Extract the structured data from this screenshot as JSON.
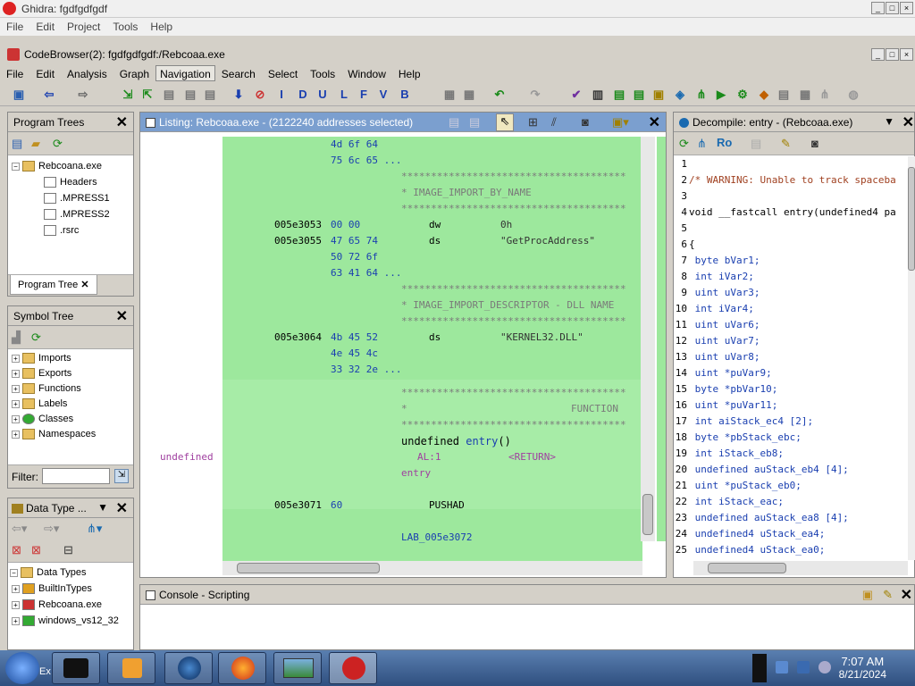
{
  "outer": {
    "title": "Ghidra: fgdfgdfgdf",
    "menu": [
      "File",
      "Edit",
      "Project",
      "Tools",
      "Help"
    ]
  },
  "inner": {
    "title": "CodeBrowser(2): fgdfgdfgdf:/Rebcoaa.exe",
    "menu": [
      "File",
      "Edit",
      "Analysis",
      "Graph",
      "Navigation",
      "Search",
      "Select",
      "Tools",
      "Window",
      "Help"
    ],
    "toolbar_letters": [
      "I",
      "D",
      "U",
      "L",
      "F",
      "V",
      "B"
    ]
  },
  "program_trees": {
    "title": "Program Trees",
    "root": "Rebcoana.exe",
    "items": [
      "Headers",
      ".MPRESS1",
      ".MPRESS2",
      ".rsrc"
    ],
    "tab": "Program Tree"
  },
  "symbol_tree": {
    "title": "Symbol Tree",
    "items": [
      "Imports",
      "Exports",
      "Functions",
      "Labels",
      "Classes",
      "Namespaces"
    ],
    "filter_label": "Filter:"
  },
  "data_types": {
    "title": "Data Type ...",
    "root": "Data Types",
    "items": [
      "BuiltInTypes",
      "Rebcoana.exe",
      "windows_vs12_32"
    ]
  },
  "listing": {
    "title": "Listing:  Rebcoaa.exe - (2122240 addresses selected)",
    "rows": [
      {
        "addr": "",
        "bytes": "4d 6f 64",
        "mn": "",
        "op": ""
      },
      {
        "addr": "",
        "bytes": "75 6c 65 ...",
        "mn": "",
        "op": ""
      },
      {
        "star": "**************************************"
      },
      {
        "comment": "* IMAGE_IMPORT_BY_NAME"
      },
      {
        "star": "**************************************"
      },
      {
        "addr": "005e3053",
        "bytes": "00 00",
        "mn": "dw",
        "op": "0h"
      },
      {
        "addr": "005e3055",
        "bytes": "47 65 74",
        "mn": "ds",
        "op": "\"GetProcAddress\""
      },
      {
        "addr": "",
        "bytes": "50 72 6f",
        "mn": "",
        "op": ""
      },
      {
        "addr": "",
        "bytes": "63 41 64 ...",
        "mn": "",
        "op": ""
      },
      {
        "star": "**************************************"
      },
      {
        "comment": "* IMAGE_IMPORT_DESCRIPTOR - DLL NAME"
      },
      {
        "star": "**************************************"
      },
      {
        "addr": "005e3064",
        "bytes": "4b 45 52",
        "mn": "ds",
        "op": "\"KERNEL32.DLL\""
      },
      {
        "addr": "",
        "bytes": "4e 45 4c",
        "mn": "",
        "op": ""
      },
      {
        "addr": "",
        "bytes": "33 32 2e ...",
        "mn": "",
        "op": ""
      }
    ],
    "func_star": "**************************************",
    "func_comment_left": "*",
    "func_comment_right": "FUNCTION",
    "func_sig_type": "undefined ",
    "func_sig_name": "entry",
    "func_sig_paren": "()",
    "ret_type": "undefined",
    "ret_reg": "AL:1",
    "ret_label": "<RETURN>",
    "entry_label": "entry",
    "pushad": {
      "addr": "005e3071",
      "bytes": "60",
      "mn": "PUSHAD"
    },
    "lab_label": "LAB_005e3072"
  },
  "decompile": {
    "title": "Decompile: entry -  (Rebcoaa.exe)",
    "lines": [
      {
        "n": "1",
        "text": ""
      },
      {
        "n": "2",
        "text": "/* WARNING: Unable to track spaceba"
      },
      {
        "n": "3",
        "text": ""
      },
      {
        "n": "4",
        "text": "void __fastcall entry(undefined4 pa"
      },
      {
        "n": "5",
        "text": ""
      },
      {
        "n": "6",
        "text": "{"
      },
      {
        "n": "7",
        "text": "  byte bVar1;"
      },
      {
        "n": "8",
        "text": "  int iVar2;"
      },
      {
        "n": "9",
        "text": "  uint uVar3;"
      },
      {
        "n": "10",
        "text": "  int iVar4;"
      },
      {
        "n": "11",
        "text": "  uint uVar6;"
      },
      {
        "n": "12",
        "text": "  uint uVar7;"
      },
      {
        "n": "13",
        "text": "  uint uVar8;"
      },
      {
        "n": "14",
        "text": "  uint *puVar9;"
      },
      {
        "n": "15",
        "text": "  byte *pbVar10;"
      },
      {
        "n": "16",
        "text": "  uint *puVar11;"
      },
      {
        "n": "17",
        "text": "  int aiStack_ec4 [2];"
      },
      {
        "n": "18",
        "text": "  byte *pbStack_ebc;"
      },
      {
        "n": "19",
        "text": "  int iStack_eb8;"
      },
      {
        "n": "20",
        "text": "  undefined auStack_eb4 [4];"
      },
      {
        "n": "21",
        "text": "  uint *puStack_eb0;"
      },
      {
        "n": "22",
        "text": "  int iStack_eac;"
      },
      {
        "n": "23",
        "text": "  undefined auStack_ea8 [4];"
      },
      {
        "n": "24",
        "text": "  undefined4 uStack_ea4;"
      },
      {
        "n": "25",
        "text": "  undefined4 uStack_ea0;"
      }
    ]
  },
  "console": {
    "title": "Console - Scripting"
  },
  "taskbar": {
    "time": "7:07 AM",
    "date": "8/21/2024",
    "start_label": "Ex"
  }
}
